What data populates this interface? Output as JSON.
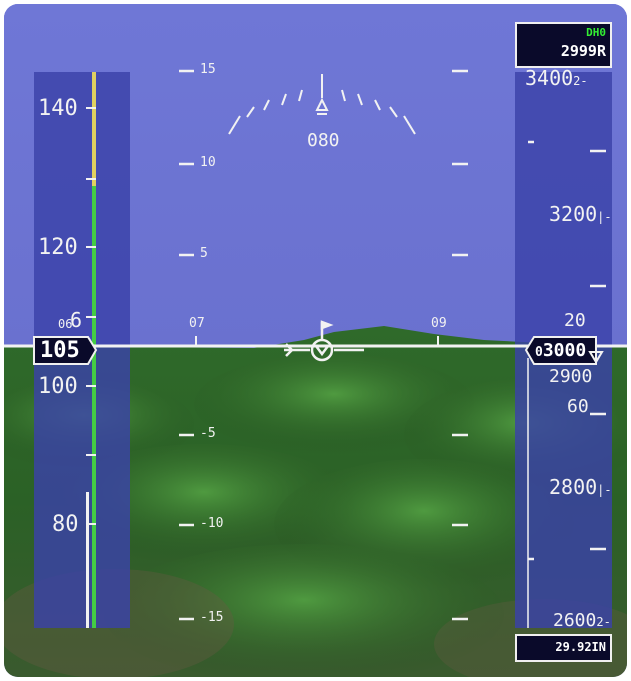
{
  "airspeed": {
    "current": "105",
    "tape_labels": [
      "140",
      "120",
      "100",
      "80"
    ],
    "partial_top": "6",
    "partial_tick": "06"
  },
  "heading": {
    "current": "080",
    "tape_left": "07",
    "tape_right": "09"
  },
  "pitch_ladder": {
    "up_labels": [
      "15",
      "10",
      "5"
    ],
    "down_labels": [
      "-5",
      "-10",
      "-15"
    ]
  },
  "altitude": {
    "current": "3000",
    "current_prefix": "0",
    "tape_labels": [
      "3400",
      "3200",
      "2900",
      "2800",
      "2600"
    ],
    "label_suffixes": [
      "2-",
      "|-",
      "|-",
      "2-"
    ],
    "roll_digits_upper": "20",
    "roll_digits_lower": "60"
  },
  "minimums": {
    "label": "DH0",
    "value": "2999R"
  },
  "baro_setting": "29.92IN",
  "colors": {
    "sky": "#6c73d2",
    "tape": "#3a42a8",
    "speed_green": "#44cc44",
    "speed_yellow": "#e0d060",
    "minimums_label": "#33ee33",
    "symbology": "#f2f2f2"
  }
}
